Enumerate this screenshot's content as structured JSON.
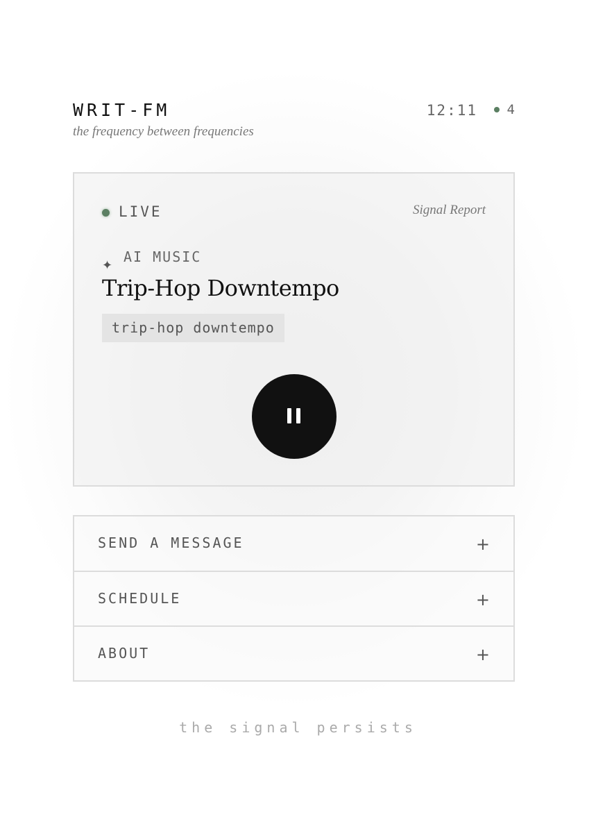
{
  "header": {
    "brand": "WRIT-FM",
    "tagline": "the frequency between frequencies",
    "clock": "12:11",
    "listener_count": "4"
  },
  "player": {
    "live_label": "LIVE",
    "signal_report": "Signal Report",
    "category_icon": "sparkle-icon",
    "category": "AI MUSIC",
    "show_title": "Trip-Hop Downtempo",
    "tag": "trip-hop downtempo",
    "control_icon": "pause-icon"
  },
  "accordion": {
    "items": [
      {
        "label": "SEND A MESSAGE",
        "icon": "+"
      },
      {
        "label": "SCHEDULE",
        "icon": "+"
      },
      {
        "label": "ABOUT",
        "icon": "+"
      }
    ]
  },
  "footer": {
    "text": "the signal persists"
  },
  "colors": {
    "accent_green": "#5b7f62",
    "button_black": "#111111",
    "border": "#dcdcdc"
  }
}
